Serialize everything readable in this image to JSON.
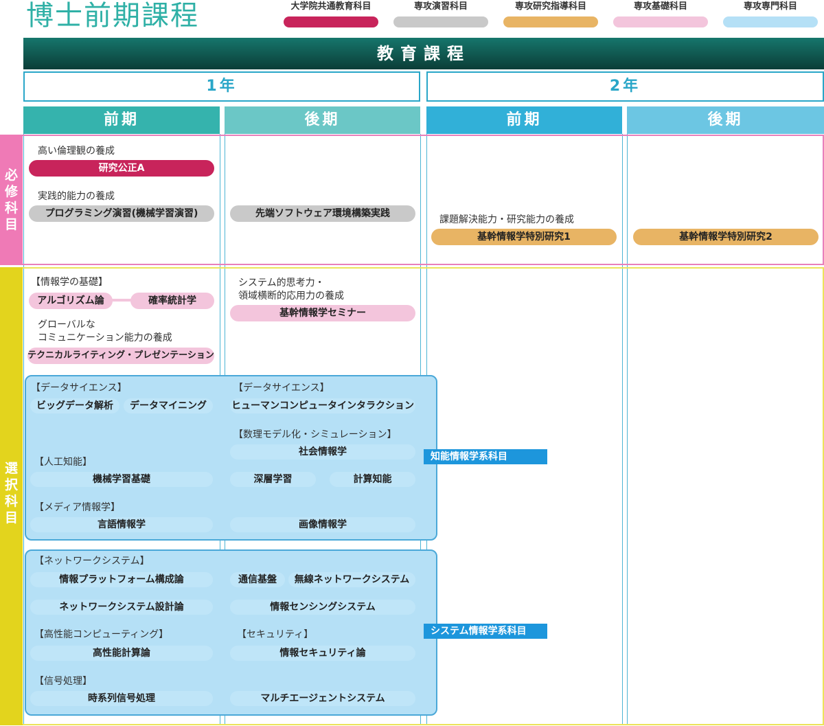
{
  "title": "博士前期課程",
  "legend": [
    {
      "label": "大学院共通教育科目",
      "color": "#c8245b"
    },
    {
      "label": "専攻演習科目",
      "color": "#c9c9c9"
    },
    {
      "label": "専攻研究指導科目",
      "color": "#e8b464"
    },
    {
      "label": "専攻基礎科目",
      "color": "#f3c5dc"
    },
    {
      "label": "専攻専門科目",
      "color": "#b5e0f6"
    }
  ],
  "header": "教育課程",
  "years": [
    "1年",
    "2年"
  ],
  "terms": [
    "前期",
    "後期",
    "前期",
    "後期"
  ],
  "required": {
    "side_label": "必修科目",
    "ethics_label": "高い倫理観の養成",
    "ethics_course": "研究公正A",
    "practical_label": "実践的能力の養成",
    "programming_course": "プログラミング演習(機械学習演習)",
    "software_course": "先端ソフトウェア環境構築実践",
    "research_label": "課題解決能力・研究能力の養成",
    "research1": "基幹情報学特別研究1",
    "research2": "基幹情報学特別研究2"
  },
  "elective": {
    "side_label": "選択科目",
    "basics_label": "【情報学の基礎】",
    "algorithm": "アルゴリズム論",
    "probability": "確率統計学",
    "global_label_1": "グローバルな",
    "global_label_2": "コミュニケーション能力の養成",
    "technical_writing": "テクニカルライティング・プレゼンテーション",
    "system_label_1": "システム的思考力・",
    "system_label_2": "領域横断的応用力の養成",
    "seminar": "基幹情報学セミナー",
    "intelligent": {
      "tag": "知能情報学系科目",
      "ds1_label": "【データサイエンス】",
      "bigdata": "ビッグデータ解析",
      "datamining": "データマイニング",
      "ds2_label": "【データサイエンス】",
      "hci": "ヒューマンコンピュータインタラクション",
      "math_label": "【数理モデル化・シミュレーション】",
      "social": "社会情報学",
      "ai_label": "【人工知能】",
      "ml_basics": "機械学習基礎",
      "deep": "深層学習",
      "computational": "計算知能",
      "media_label": "【メディア情報学】",
      "language": "言語情報学",
      "image": "画像情報学"
    },
    "systems": {
      "tag": "システム情報学系科目",
      "network_label": "【ネットワークシステム】",
      "platform": "情報プラットフォーム構成論",
      "comm": "通信基盤",
      "wireless": "無線ネットワークシステム",
      "netdesign": "ネットワークシステム設計論",
      "sensing": "情報センシングシステム",
      "hpc_label": "【高性能コンピューティング】",
      "hpc": "高性能計算論",
      "security_label": "【セキュリティ】",
      "security": "情報セキュリティ論",
      "signal_label": "【信号処理】",
      "timeseries": "時系列信号処理",
      "multiagent": "マルチエージェントシステム"
    }
  }
}
